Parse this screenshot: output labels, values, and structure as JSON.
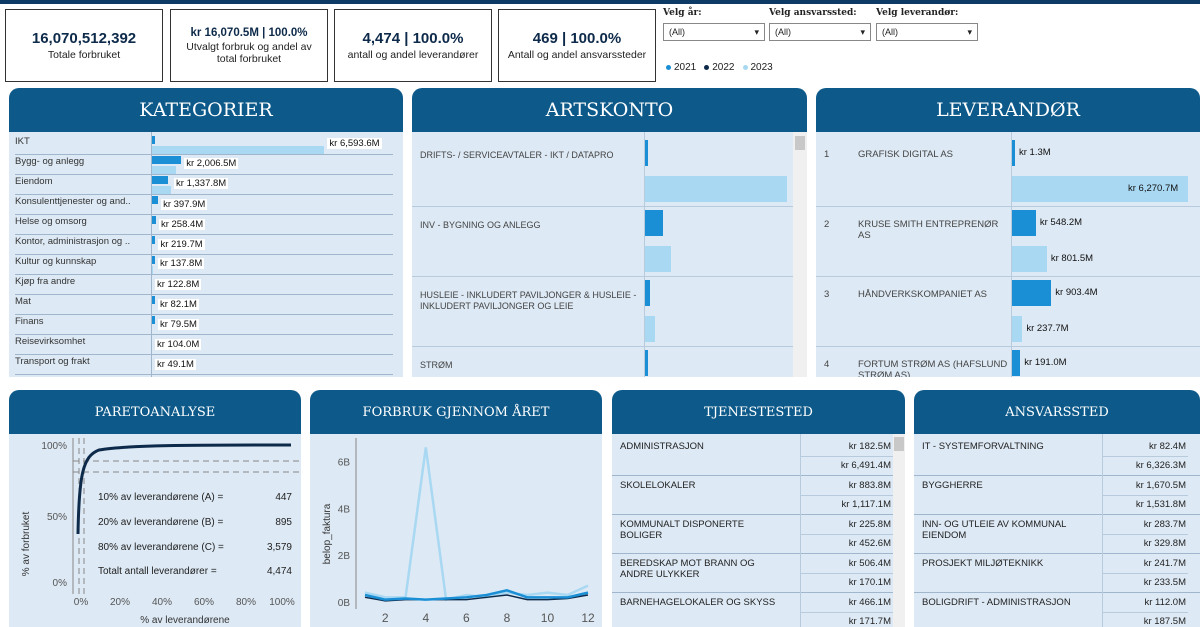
{
  "kpis": [
    {
      "value": "16,070,512,392",
      "label": "Totale forbruket"
    },
    {
      "value": "kr 16,070.5M | 100.0%",
      "label": "Utvalgt forbruk og andel av total forbruket"
    },
    {
      "value": "4,474 | 100.0%",
      "label": "antall og andel leverandører"
    },
    {
      "value": "469 | 100.0%",
      "label": "Antall og andel ansvarssteder"
    }
  ],
  "filters": [
    {
      "label": "Velg år:",
      "value": "(All)"
    },
    {
      "label": "Velg ansvarssted:",
      "value": "(All)"
    },
    {
      "label": "Velg leverandør:",
      "value": "(All)"
    }
  ],
  "legend": [
    {
      "year": "2021",
      "color": "#1a8fd6"
    },
    {
      "year": "2022",
      "color": "#0d2a4a"
    },
    {
      "year": "2023",
      "color": "#a9d8f2"
    }
  ],
  "kategorier": {
    "title": "KATEGORIER",
    "rows": [
      {
        "label": "IKT",
        "v2021": 98.1,
        "v2023": 6495.5,
        "text": "kr 6,593.6M"
      },
      {
        "label": "Bygg- og anlegg",
        "v2021": 1100,
        "v2023": 906.5,
        "text": "kr 2,006.5M"
      },
      {
        "label": "Eiendom",
        "v2021": 620,
        "v2023": 717.8,
        "text": "kr 1,337.8M"
      },
      {
        "label": "Konsulenttjenester og and..",
        "v2021": 230,
        "v2023": 0,
        "text": "kr 397.9M"
      },
      {
        "label": "Helse og omsorg",
        "v2021": 150,
        "v2023": 0,
        "text": "kr 258.4M"
      },
      {
        "label": "Kontor, administrasjon og ..",
        "v2021": 130,
        "v2023": 0,
        "text": "kr 219.7M"
      },
      {
        "label": "Kultur og kunnskap",
        "v2021": 40,
        "v2023": 50,
        "text": "kr 137.8M"
      },
      {
        "label": "Kjøp fra andre",
        "v2021": 0,
        "v2023": 0,
        "text": "kr 122.8M"
      },
      {
        "label": "Mat",
        "v2021": 40,
        "v2023": 0,
        "text": "kr 82.1M"
      },
      {
        "label": "Finans",
        "v2021": 30,
        "v2023": 0,
        "text": "kr 79.5M"
      },
      {
        "label": "Reisevirksomhet",
        "v2021": 0,
        "v2023": 0,
        "text": "kr 104.0M"
      },
      {
        "label": "Transport og frakt",
        "v2021": 0,
        "v2023": 0,
        "text": "kr 49.1M"
      }
    ]
  },
  "artskonto": {
    "title": "ARTSKONTO",
    "rows": [
      {
        "label": "DRIFTS- / SERVICEAVTALER - IKT / DATAPRO",
        "v2021": 15,
        "v2023": 6200
      },
      {
        "label": "INV - BYGNING OG ANLEGG",
        "v2021": 1100,
        "v2023": 1150
      },
      {
        "label": "HUSLEIE - INKLUDERT PAVILJONGER & HUSLEIE - INKLUDERT PAVILJONGER OG LEIE",
        "v2021": 300,
        "v2023": 430
      },
      {
        "label": "STRØM",
        "v2021": 200,
        "v2023": 0
      }
    ]
  },
  "leverandor": {
    "title": "LEVERANDØR",
    "rows": [
      {
        "num": "1",
        "name": "GRAFISK DIGITAL AS",
        "v2021": 1.3,
        "t2021": "kr 1.3M",
        "v2023": 6270.7,
        "t2023": "kr 6,270.7M"
      },
      {
        "num": "2",
        "name": "KRUSE SMITH ENTREPRENØR AS",
        "v2021": 548.2,
        "t2021": "kr 548.2M",
        "v2023": 801.5,
        "t2023": "kr 801.5M"
      },
      {
        "num": "3",
        "name": "HÅNDVERKSKOMPANIET AS",
        "v2021": 903.4,
        "t2021": "kr 903.4M",
        "v2023": 237.7,
        "t2023": "kr 237.7M"
      },
      {
        "num": "4",
        "name": "FORTUM STRØM AS (HAFSLUND STRØM AS)",
        "v2021": 191.0,
        "t2021": "kr 191.0M",
        "v2023": 0,
        "t2023": ""
      }
    ]
  },
  "pareto": {
    "title": "PARETOANALYSE",
    "ylabel": "% av forbruket",
    "xlabel": "% av leverandørene",
    "yticks": [
      "100%",
      "50%",
      "0%"
    ],
    "xticks": [
      "0%",
      "20%",
      "40%",
      "60%",
      "80%",
      "100%"
    ],
    "stats": [
      {
        "label": "10% av leverandørene (A) =",
        "value": "447"
      },
      {
        "label": "20% av leverandørene (B) =",
        "value": "895"
      },
      {
        "label": "80% av leverandørene (C) =",
        "value": "3,579"
      },
      {
        "label": "Totalt antall leverandører =",
        "value": "4,474"
      }
    ]
  },
  "forbruk": {
    "title": "FORBRUK GJENNOM ÅRET",
    "ylabel": "belop_faktura",
    "yticks": [
      "6B",
      "4B",
      "2B",
      "0B"
    ],
    "xticks": [
      "2",
      "4",
      "6",
      "8",
      "10",
      "12"
    ]
  },
  "chart_data": {
    "type": "line",
    "title": "FORBRUK GJENNOM ÅRET",
    "xlabel": "",
    "ylabel": "belop_faktura",
    "x": [
      1,
      2,
      3,
      4,
      5,
      6,
      7,
      8,
      9,
      10,
      11,
      12
    ],
    "ylim": [
      0,
      7
    ],
    "series": [
      {
        "name": "2021",
        "values": [
          0.3,
          0.1,
          0.15,
          0.1,
          0.15,
          0.2,
          0.3,
          0.5,
          0.2,
          0.2,
          0.2,
          0.4
        ]
      },
      {
        "name": "2022",
        "values": [
          0.2,
          0.05,
          0.1,
          0.1,
          0.1,
          0.1,
          0.2,
          0.3,
          0.1,
          0.1,
          0.15,
          0.3
        ]
      },
      {
        "name": "2023",
        "values": [
          0.4,
          0.2,
          0.2,
          6.6,
          0.1,
          0.3,
          0.2,
          0.4,
          0.3,
          0.4,
          0.3,
          0.7
        ]
      }
    ]
  },
  "tjenestested": {
    "title": "TJENESTESTED",
    "rows": [
      {
        "name": "ADMINISTRASJON",
        "a": "kr 182.5M",
        "b": "kr 6,491.4M"
      },
      {
        "name": "SKOLELOKALER",
        "a": "kr 883.8M",
        "b": "kr 1,117.1M"
      },
      {
        "name": "KOMMUNALT DISPONERTE BOLIGER",
        "a": "kr 225.8M",
        "b": "kr 452.6M"
      },
      {
        "name": "BEREDSKAP MOT BRANN OG ANDRE ULYKKER",
        "a": "kr 506.4M",
        "b": "kr 170.1M"
      },
      {
        "name": "BARNEHAGELOKALER OG SKYSS",
        "a": "kr 466.1M",
        "b": "kr 171.7M"
      }
    ]
  },
  "ansvarssted": {
    "title": "ANSVARSSTED",
    "rows": [
      {
        "name": "IT - SYSTEMFORVALTNING",
        "a": "kr 82.4M",
        "b": "kr 6,326.3M"
      },
      {
        "name": "BYGGHERRE",
        "a": "kr 1,670.5M",
        "b": "kr 1,531.8M"
      },
      {
        "name": "INN- OG UTLEIE AV KOMMUNAL EIENDOM",
        "a": "kr 283.7M",
        "b": "kr 329.8M"
      },
      {
        "name": "PROSJEKT MILJØTEKNIKK",
        "a": "kr 241.7M",
        "b": "kr 233.5M"
      },
      {
        "name": "BOLIGDRIFT - ADMINISTRASJON",
        "a": "kr 112.0M",
        "b": "kr 187.5M"
      }
    ]
  }
}
